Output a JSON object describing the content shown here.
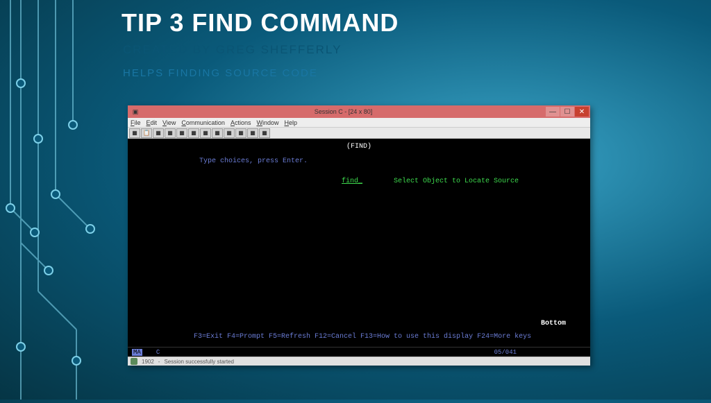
{
  "slide": {
    "title": "TIP 3 FIND COMMAND",
    "author": "CREATED BY GREG SHEFFERLY",
    "description": "HELPS FINDING SOURCE CODE"
  },
  "window": {
    "title": "Session C - [24 x 80]"
  },
  "menu": {
    "file": "File",
    "edit": "Edit",
    "view": "View",
    "communication": "Communication",
    "actions": "Actions",
    "window": "Window",
    "help": "Help"
  },
  "terminal": {
    "header": "(FIND)",
    "prompt": "Type choices, press Enter.",
    "input": "find_",
    "inputDesc": "Select Object to Locate Source",
    "bottom": "Bottom",
    "fkeys": "F3=Exit   F4=Prompt   F5=Refresh   F12=Cancel   F13=How to use this display   F24=More keys",
    "statusMode": "MA",
    "statusSession": "C",
    "statusCoord": "05/041"
  },
  "statusbar": {
    "code": "1902",
    "message": "Session successfully started"
  }
}
